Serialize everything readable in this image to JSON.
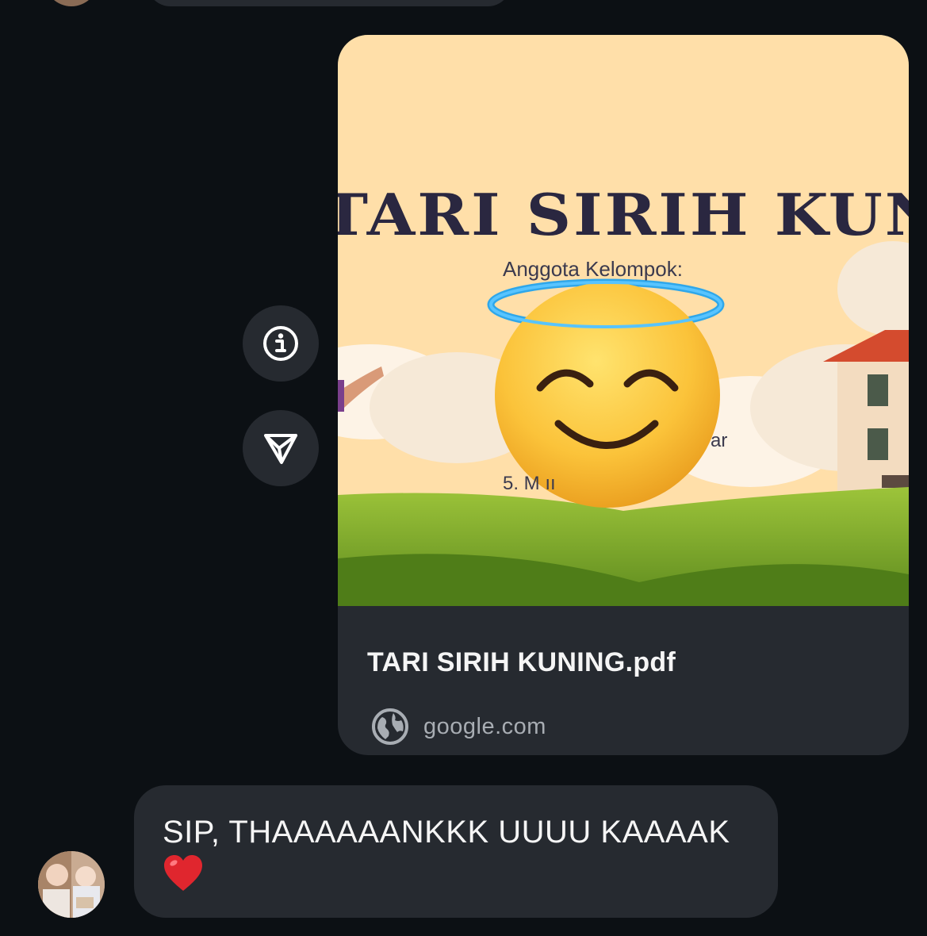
{
  "conversation": {
    "link_preview": {
      "thumbnail": {
        "title": "TARI SIRIH KUNING",
        "subtitle": "Anggota Kelompok:",
        "item_a": "ar",
        "item_b": "5.  M             ıı",
        "sticker": "smiling-face-with-halo"
      },
      "title": "TARI SIRIH KUNING.pdf",
      "domain": "google.com"
    },
    "actions": {
      "info_icon": "info-circle-icon",
      "share_icon": "send-icon"
    },
    "received_message": {
      "text": "SIP, THAAAAAANKKK UUUU KAAAAK",
      "emoji": "red-heart"
    }
  },
  "colors": {
    "background": "#0c1014",
    "bubble": "#262a30",
    "text": "#f5f5f5",
    "muted_text": "#a8adb3",
    "thumbnail_bg": "#ffdfa9",
    "heart": "#e0262e"
  }
}
